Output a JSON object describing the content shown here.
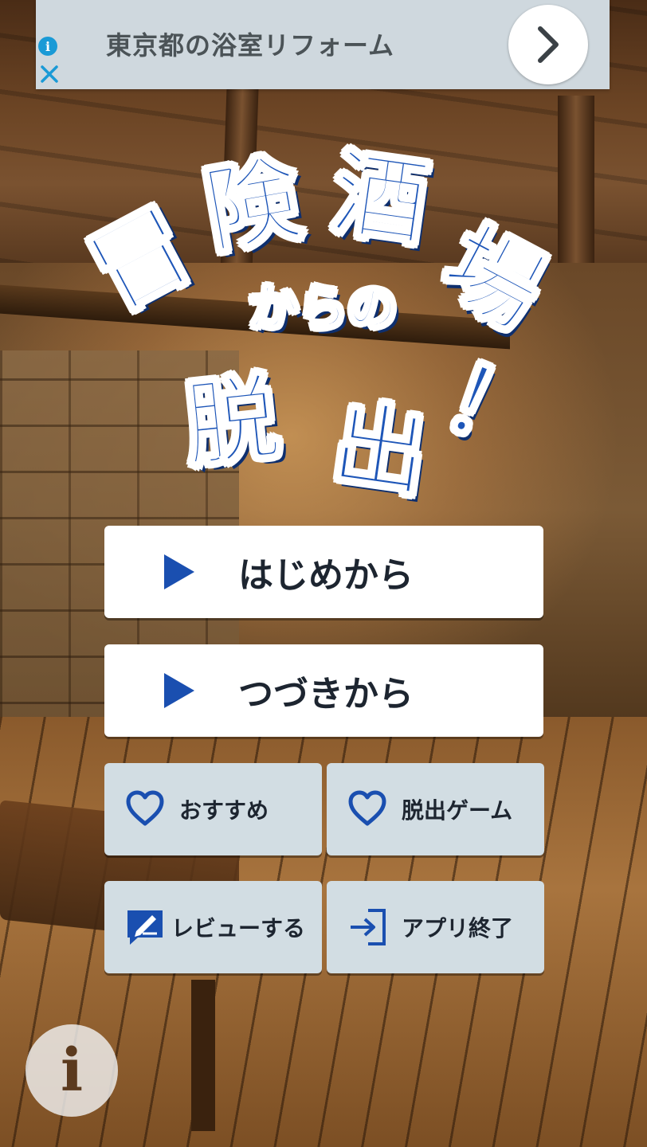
{
  "ad": {
    "text": "東京都の浴室リフォーム",
    "info_symbol": "i"
  },
  "title": {
    "line1": [
      "冒",
      "険",
      "酒",
      "場"
    ],
    "line2": "からの",
    "line3": [
      "脱",
      "出",
      "！"
    ]
  },
  "menu": {
    "start_label": "はじめから",
    "continue_label": "つづきから",
    "recommend_label": "おすすめ",
    "escape_games_label": "脱出ゲーム",
    "review_label": "レビューする",
    "exit_label": "アプリ終了"
  },
  "info_button": {
    "symbol": "i"
  },
  "colors": {
    "title_blue": "#1e56b8",
    "button_white": "#ffffff",
    "button_gray": "#d2dde3",
    "icon_blue": "#1a4fb0",
    "ad_background": "#cfd8de"
  }
}
